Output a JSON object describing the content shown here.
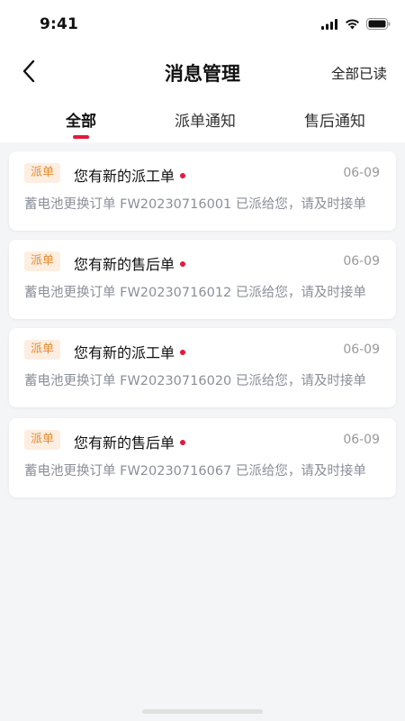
{
  "status": {
    "time": "9:41"
  },
  "header": {
    "title": "消息管理",
    "read_all": "全部已读"
  },
  "tabs": [
    {
      "label": "全部",
      "active": true
    },
    {
      "label": "派单通知",
      "active": false
    },
    {
      "label": "售后通知",
      "active": false
    }
  ],
  "messages": [
    {
      "tag": "派单",
      "title": "您有新的派工单",
      "date": "06-09",
      "body": "蓄电池更换订单 FW20230716001 已派给您，请及时接单",
      "unread": true
    },
    {
      "tag": "派单",
      "title": "您有新的售后单",
      "date": "06-09",
      "body": "蓄电池更换订单 FW20230716012 已派给您，请及时接单",
      "unread": true
    },
    {
      "tag": "派单",
      "title": "您有新的派工单",
      "date": "06-09",
      "body": "蓄电池更换订单 FW20230716020 已派给您，请及时接单",
      "unread": true
    },
    {
      "tag": "派单",
      "title": "您有新的售后单",
      "date": "06-09",
      "body": "蓄电池更换订单 FW20230716067 已派给您，请及时接单",
      "unread": true
    }
  ],
  "colors": {
    "accent": "#e3193b",
    "badge_text": "#e58a2f",
    "badge_bg": "#fdeee1",
    "background": "#f4f5f7"
  },
  "icons": {
    "back": "chevron-left-icon",
    "signal": "signal-icon",
    "wifi": "wifi-icon",
    "battery": "battery-icon"
  }
}
